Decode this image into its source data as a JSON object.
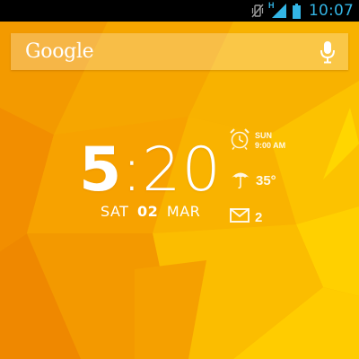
{
  "status_bar": {
    "time": "10:07",
    "network_label": "H",
    "time_color": "#33b5e5",
    "icons": [
      "vibrate-icon",
      "signal-icon",
      "battery-icon"
    ]
  },
  "search": {
    "logo_text": "Google",
    "mic_icon": "mic-icon"
  },
  "clock": {
    "hour": "5",
    "separator": ":",
    "minutes": "20",
    "weekday": "SAT",
    "day": "02",
    "month": "MAR"
  },
  "alarm": {
    "icon": "alarm-clock-icon",
    "day": "SUN",
    "time": "9:00 AM"
  },
  "weather": {
    "icon": "umbrella-icon",
    "temperature": "35°"
  },
  "mail": {
    "icon": "gmail-icon",
    "count": "2"
  },
  "colors": {
    "wallpaper_base": "#f7a900",
    "wallpaper_dark": "#f08a00",
    "wallpaper_light": "#ffd000"
  }
}
